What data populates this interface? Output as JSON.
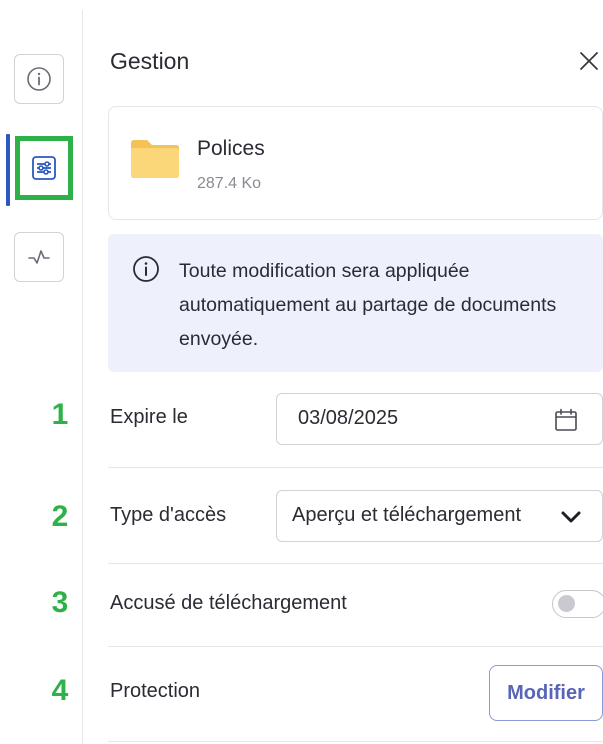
{
  "panel": {
    "title": "Gestion"
  },
  "file": {
    "name": "Polices",
    "size": "287.4 Ko"
  },
  "notice": {
    "text": "Toute modification sera appliquée automatiquement au partage de documents envoyée."
  },
  "settings": {
    "expiry": {
      "number": "1",
      "label": "Expire le",
      "value": "03/08/2025"
    },
    "access_type": {
      "number": "2",
      "label": "Type d'accès",
      "value": "Aperçu et téléchargement"
    },
    "download_receipt": {
      "number": "3",
      "label": "Accusé de téléchargement",
      "enabled": false
    },
    "protection": {
      "number": "4",
      "label": "Protection",
      "button_label": "Modifier"
    }
  },
  "icons": {
    "rail": [
      "info-icon",
      "sliders-icon",
      "activity-icon"
    ],
    "close": "close-icon",
    "folder": "folder-icon",
    "calendar": "calendar-icon",
    "chevron": "chevron-down-icon"
  },
  "colors": {
    "accent_green": "#2fb14a",
    "active_blue": "#2b59c3",
    "notice_bg": "#eef1fb",
    "button_text": "#5865b8",
    "folder_yellow": "#fbd77a"
  }
}
